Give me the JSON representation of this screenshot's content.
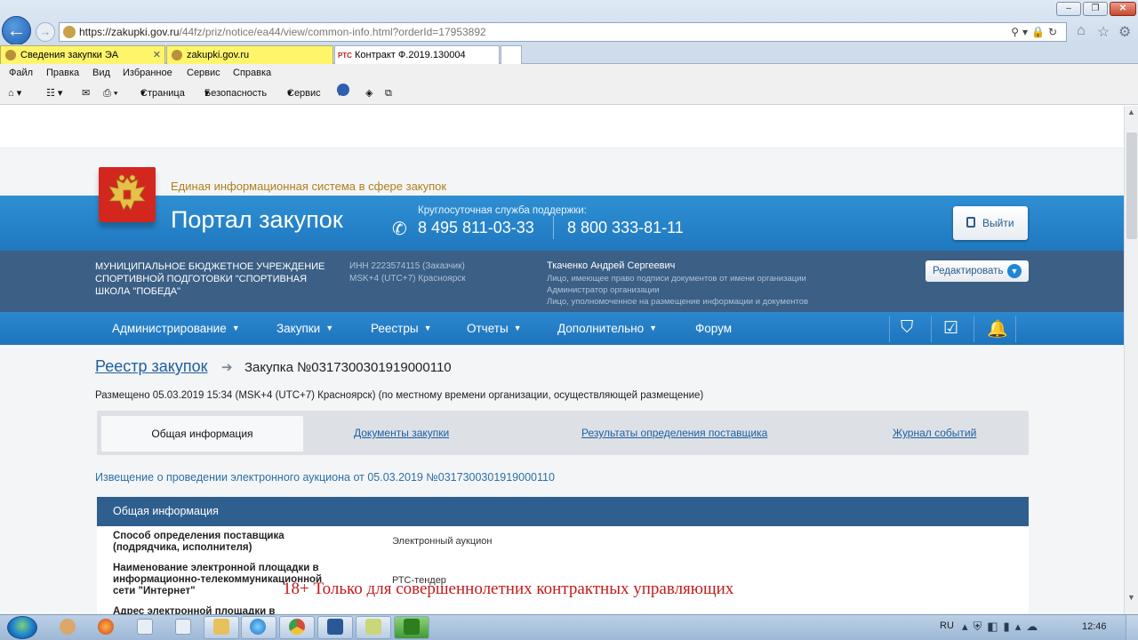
{
  "browser": {
    "url_host": "https://zakupki.gov.ru",
    "url_path": "/44fz/priz/notice/ea44/view/common-info.html?orderId=17953892",
    "tabs": [
      {
        "label": "Сведения закупки ЭА"
      },
      {
        "label": "zakupki.gov.ru"
      },
      {
        "label": "Контракт Ф.2019.130004"
      }
    ],
    "menu": [
      "Файл",
      "Правка",
      "Вид",
      "Избранное",
      "Сервис",
      "Справка"
    ],
    "commands": [
      "Страница",
      "Безопасность",
      "Сервис"
    ]
  },
  "header": {
    "system_name": "Единая информационная система в сфере закупок",
    "portal_title": "Портал закупок",
    "support_label": "Круглосуточная служба поддержки:",
    "phone_1": "8 495 811-03-33",
    "phone_2": "8 800 333-81-11",
    "logout_label": "Выйти"
  },
  "org": {
    "name": "МУНИЦИПАЛЬНОЕ БЮДЖЕТНОЕ УЧРЕЖДЕНИЕ СПОРТИВНОЙ ПОДГОТОВКИ \"СПОРТИВНАЯ ШКОЛА \"ПОБЕДА\"",
    "inn": "ИНН 2223574115 (Заказчик)",
    "timezone": "MSK+4 (UTC+7) Красноярск",
    "user_name": "Ткаченко Андрей Сергеевич",
    "user_roles": [
      "Лицо, имеющее право подписи документов от имени организации",
      "Администратор организации",
      "Лицо, уполномоченное на размещение информации и документов"
    ],
    "edit_label": "Редактировать"
  },
  "nav": {
    "items": [
      "Администрирование",
      "Закупки",
      "Реестры",
      "Отчеты",
      "Дополнительно",
      "Форум"
    ]
  },
  "main": {
    "breadcrumb_link": "Реестр закупок",
    "breadcrumb_current": "Закупка №0317300301919000110",
    "posted_text": "Размещено 05.03.2019 15:34 (MSK+4 (UTC+7) Красноярск) (по местному времени организации, осуществляющей размещение)",
    "tabs": [
      {
        "label": "Общая информация"
      },
      {
        "label": "Документы закупки"
      },
      {
        "label": "Результаты определения поставщика"
      },
      {
        "label": "Журнал событий"
      }
    ],
    "notice_title": "Извещение о проведении электронного аукциона от 05.03.2019 №0317300301919000110",
    "section_title": "Общая информация",
    "rows": [
      {
        "label": "Способ определения поставщика (подрядчика, исполнителя)",
        "value": "Электронный аукцион"
      },
      {
        "label": "Наименование электронной площадки в информационно-телекоммуникационной сети \"Интернет\"",
        "value": "РТС-тендер"
      },
      {
        "label": "Адрес электронной площадки в",
        "value": ""
      }
    ]
  },
  "overlay_text": "18+ Только для совершеннолетних контрактных управляющих",
  "taskbar": {
    "language": "RU",
    "time": "12:46"
  }
}
